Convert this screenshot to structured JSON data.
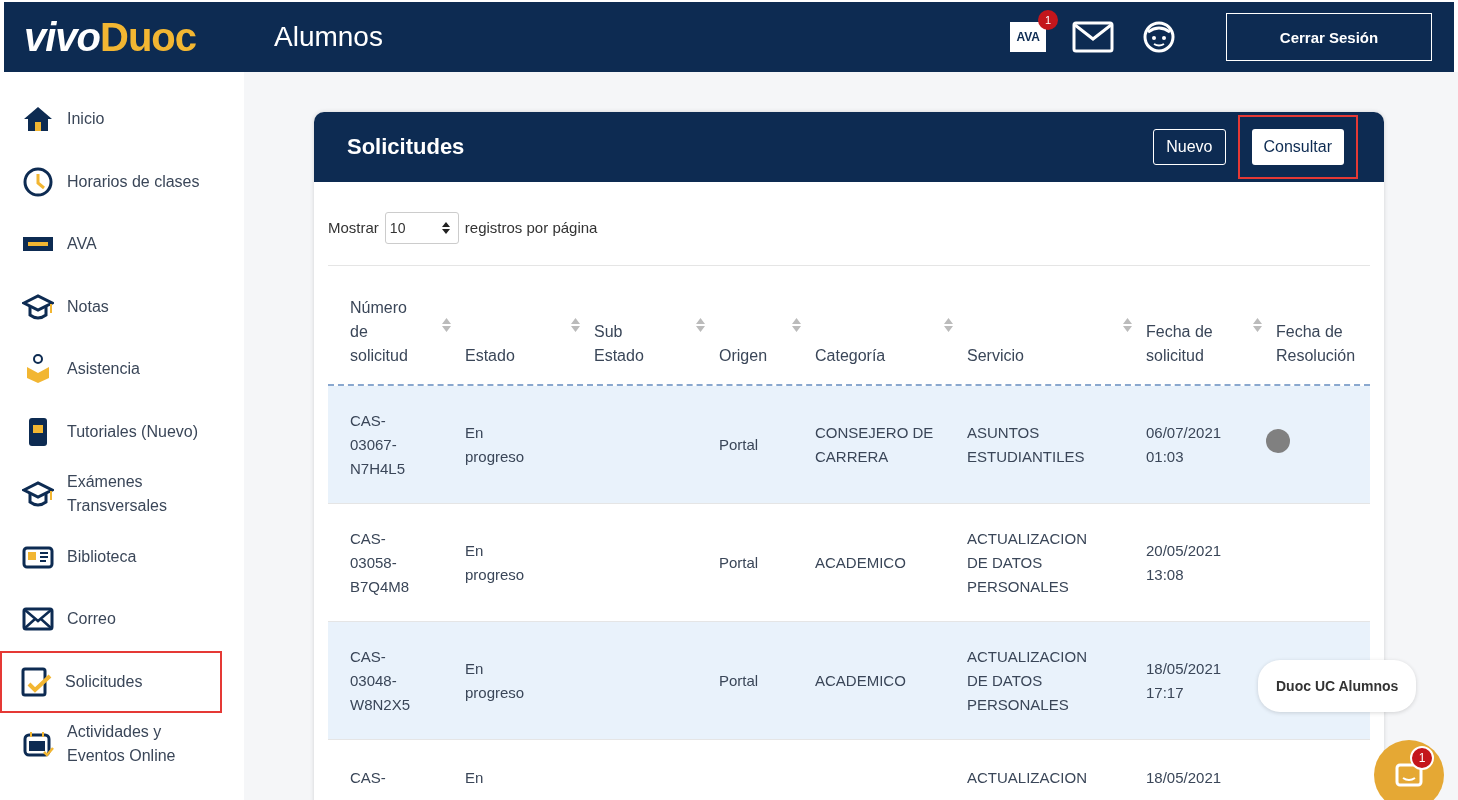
{
  "header": {
    "logo": [
      "vivo",
      "Duoc"
    ],
    "title": "Alumnos",
    "ava_badge": "AVA",
    "notification_count": "1",
    "logout": "Cerrar Sesión"
  },
  "sidebar": {
    "items": [
      {
        "label": "Inicio",
        "kind": "home",
        "highlighted": false
      },
      {
        "label": "Horarios de clases",
        "kind": "clock",
        "highlighted": false
      },
      {
        "label": "AVA",
        "kind": "ava",
        "highlighted": false
      },
      {
        "label": "Notas",
        "kind": "cap",
        "highlighted": false
      },
      {
        "label": "Asistencia",
        "kind": "attendance",
        "highlighted": false
      },
      {
        "label": "Tutoriales (Nuevo)",
        "kind": "tablet",
        "highlighted": false
      },
      {
        "label": "Exámenes Transversales",
        "kind": "cap",
        "highlighted": false
      },
      {
        "label": "Biblioteca",
        "kind": "book",
        "highlighted": false
      },
      {
        "label": "Correo",
        "kind": "mail",
        "highlighted": false
      },
      {
        "label": "Solicitudes",
        "kind": "check",
        "highlighted": true
      },
      {
        "label": "Actividades y Eventos Online",
        "kind": "calendar",
        "highlighted": false
      }
    ]
  },
  "panel": {
    "title": "Solicitudes",
    "buttons": [
      {
        "label": "Nuevo",
        "highlighted": false
      },
      {
        "label": "Consultar",
        "highlighted": true
      }
    ],
    "page_size": {
      "before": "Mostrar",
      "value": "10",
      "after": "registros por página"
    },
    "table": {
      "columns": [
        {
          "label": "Número de solicitud",
          "sortable": true
        },
        {
          "label": "Estado",
          "sortable": true
        },
        {
          "label": "Sub Estado",
          "sortable": true
        },
        {
          "label": "Origen",
          "sortable": true
        },
        {
          "label": "Categoría",
          "sortable": true
        },
        {
          "label": "Servicio",
          "sortable": true
        },
        {
          "label": "Fecha de solicitud",
          "sortable": true
        },
        {
          "label": "Fecha de Resolución",
          "sortable": false
        }
      ],
      "rows": [
        {
          "cells": [
            "CAS-03067-N7H4L5",
            "En progreso",
            "",
            "Portal",
            "CONSEJERO DE CARRERA",
            "ASUNTOS ESTUDIANTILES",
            "06/07/2021 01:03"
          ],
          "status_dot": true
        },
        {
          "cells": [
            "CAS-03058-B7Q4M8",
            "En progreso",
            "",
            "Portal",
            "ACADEMICO",
            "ACTUALIZACION DE DATOS PERSONALES",
            "20/05/2021 13:08"
          ],
          "status_dot": false
        },
        {
          "cells": [
            "CAS-03048-W8N2X5",
            "En progreso",
            "",
            "Portal",
            "ACADEMICO",
            "ACTUALIZACION DE DATOS PERSONALES",
            "18/05/2021 17:17"
          ],
          "status_dot": false
        },
        {
          "cells": [
            "CAS-",
            "En",
            "",
            "",
            "",
            "ACTUALIZACION",
            "18/05/2021"
          ],
          "status_dot": false
        }
      ]
    }
  },
  "chat": {
    "label": "Duoc UC Alumnos",
    "count": "1"
  }
}
